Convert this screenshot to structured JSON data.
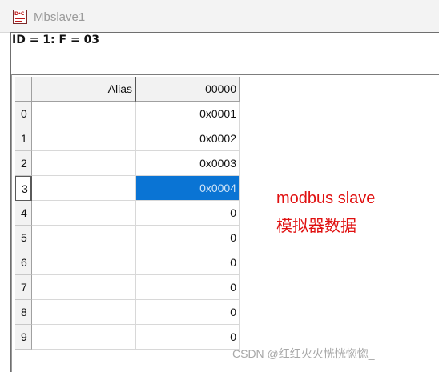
{
  "window": {
    "title": "Mbslave1"
  },
  "header": {
    "line": "ID = 1: F = 03"
  },
  "grid": {
    "alias_header": "Alias",
    "value_header": "00000",
    "selected_row": 3,
    "rows": [
      {
        "index": "0",
        "alias": "",
        "value": "0x0001"
      },
      {
        "index": "1",
        "alias": "",
        "value": "0x0002"
      },
      {
        "index": "2",
        "alias": "",
        "value": "0x0003"
      },
      {
        "index": "3",
        "alias": "",
        "value": "0x0004"
      },
      {
        "index": "4",
        "alias": "",
        "value": "0"
      },
      {
        "index": "5",
        "alias": "",
        "value": "0"
      },
      {
        "index": "6",
        "alias": "",
        "value": "0"
      },
      {
        "index": "7",
        "alias": "",
        "value": "0"
      },
      {
        "index": "8",
        "alias": "",
        "value": "0"
      },
      {
        "index": "9",
        "alias": "",
        "value": "0"
      }
    ]
  },
  "annotation": {
    "line1": "modbus slave",
    "line2": "模拟器数据",
    "color": "#e01010"
  },
  "watermark": "CSDN @红红火火恍恍惚惚_",
  "app_icon": {
    "text": "D•C",
    "name": "mbslave-app-icon"
  }
}
